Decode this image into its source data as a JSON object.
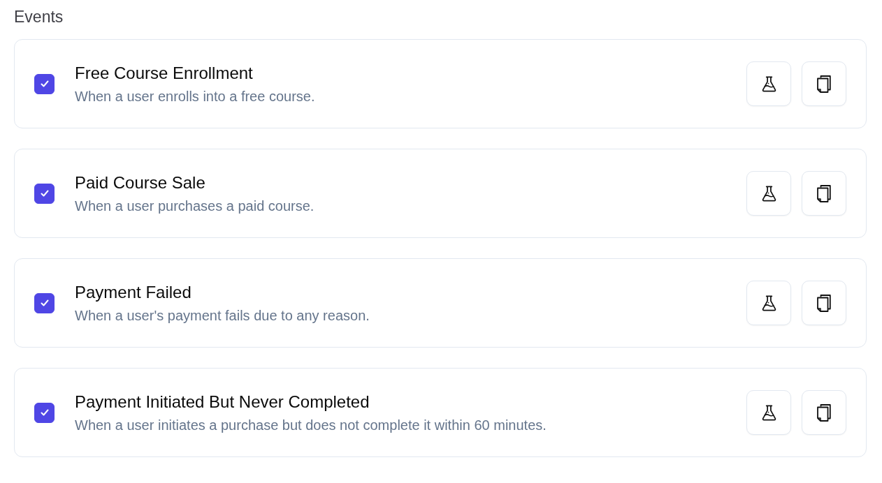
{
  "heading": "Events",
  "events": [
    {
      "title": "Free Course Enrollment",
      "description": "When a user enrolls into a free course.",
      "checked": true
    },
    {
      "title": "Paid Course Sale",
      "description": "When a user purchases a paid course.",
      "checked": true
    },
    {
      "title": "Payment Failed",
      "description": "When a user's payment fails due to any reason.",
      "checked": true
    },
    {
      "title": "Payment Initiated But Never Completed",
      "description": "When a user initiates a purchase but does not complete it within 60 minutes.",
      "checked": true
    }
  ]
}
